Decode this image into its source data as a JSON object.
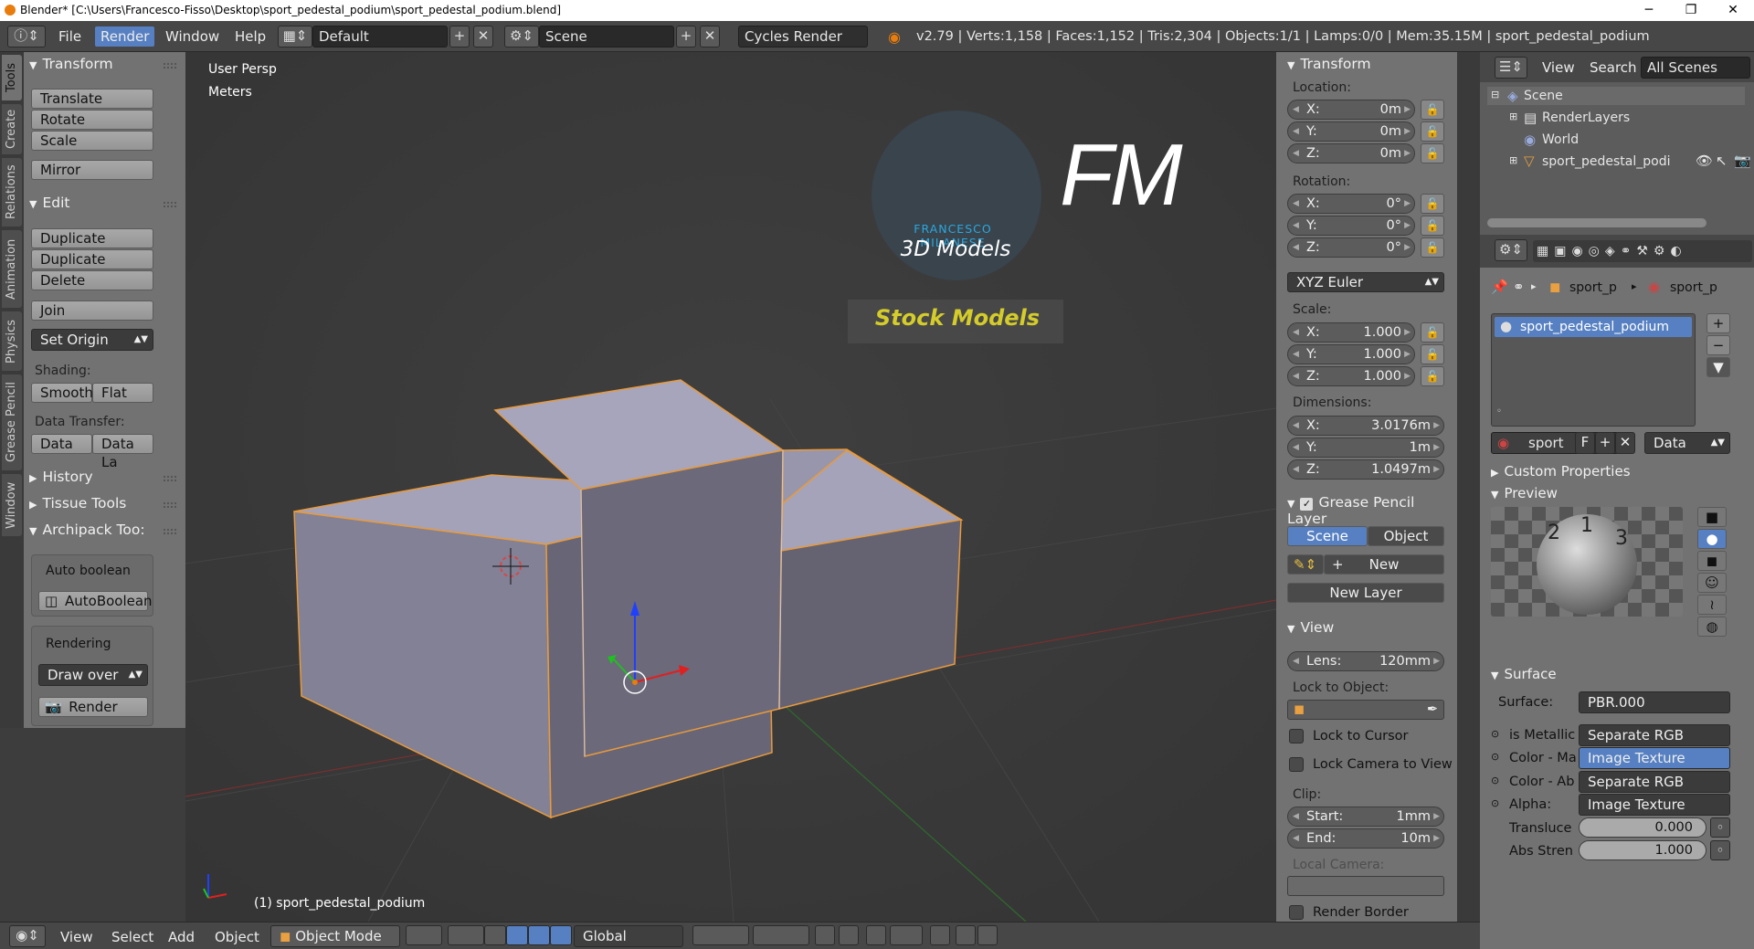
{
  "window": {
    "title": "Blender* [C:\\Users\\Francesco-Fisso\\Desktop\\sport_pedestal_podium\\sport_pedestal_podium.blend]",
    "minimize": "─",
    "maximize": "❐",
    "close": "✕"
  },
  "menubar": {
    "items": [
      "File",
      "Render",
      "Window",
      "Help"
    ],
    "layout": "Default",
    "scene": "Scene",
    "engine": "Cycles Render",
    "stats": "v2.79 | Verts:1,158 | Faces:1,152 | Tris:2,304 | Objects:1/1 | Lamps:0/0 | Mem:35.15M | sport_pedestal_podium"
  },
  "left_tabs": [
    "Tools",
    "Create",
    "Relations",
    "Animation",
    "Physics",
    "Grease Pencil",
    "Window"
  ],
  "toolshelf": {
    "transform": {
      "title": "Transform",
      "buttons": [
        "Translate",
        "Rotate",
        "Scale",
        "Mirror"
      ]
    },
    "edit": {
      "title": "Edit",
      "buttons": [
        "Duplicate",
        "Duplicate Linked",
        "Delete",
        "Join"
      ],
      "set_origin": "Set Origin",
      "shading_label": "Shading:",
      "smooth": "Smooth",
      "flat": "Flat",
      "data_transfer_label": "Data Transfer:",
      "data": "Data",
      "data_la": "Data La"
    },
    "history": "History",
    "tissue": "Tissue Tools",
    "archipack": "Archipack Too:",
    "auto_boolean_label": "Auto boolean",
    "auto_boolean_btn": "AutoBoolean",
    "rendering_label": "Rendering",
    "draw_over": "Draw over",
    "render_btn": "Render"
  },
  "viewport": {
    "view_name": "User Persp",
    "units": "Meters",
    "object_label": "(1) sport_pedestal_podium",
    "logo_fm": "FM",
    "logo_name": "FRANCESCO MILANESE",
    "logo_sub": "3D Models",
    "stock": "Stock Models"
  },
  "npanel": {
    "transform_title": "Transform",
    "location_label": "Location:",
    "loc": [
      "0m",
      "0m",
      "0m"
    ],
    "rotation_label": "Rotation:",
    "rot": [
      "0°",
      "0°",
      "0°"
    ],
    "rotation_mode": "XYZ Euler",
    "scale_label": "Scale:",
    "scale": [
      "1.000",
      "1.000",
      "1.000"
    ],
    "dimensions_label": "Dimensions:",
    "dims": [
      "3.0176m",
      "1m",
      "1.0497m"
    ],
    "axes": [
      "X:",
      "Y:",
      "Z:"
    ],
    "gp_title": "Grease Pencil Layer",
    "gp_scene": "Scene",
    "gp_object": "Object",
    "gp_new": "New",
    "gp_new_layer": "New Layer",
    "view_title": "View",
    "lens_label": "Lens:",
    "lens": "120mm",
    "lock_obj_label": "Lock to Object:",
    "lock_cursor": "Lock to Cursor",
    "lock_camera": "Lock Camera to View",
    "clip_label": "Clip:",
    "clip_start_label": "Start:",
    "clip_start": "1mm",
    "clip_end_label": "End:",
    "clip_end": "10m",
    "local_camera_label": "Local Camera:",
    "render_border": "Render Border"
  },
  "outliner": {
    "view": "View",
    "search": "Search",
    "scenes": "All Scenes",
    "items": [
      "Scene",
      "RenderLayers",
      "World",
      "sport_pedestal_podium"
    ]
  },
  "properties": {
    "breadcrumb": [
      "sport_p",
      "sport_p"
    ],
    "material_slot": "sport_pedestal_podium",
    "mat_name": "sport",
    "f_btn": "F",
    "data_dd": "Data",
    "custom_props": "Custom Properties",
    "preview": "Preview",
    "surface_title": "Surface",
    "surface_label": "Surface:",
    "surface_val": "PBR.000",
    "rows": [
      {
        "label": "is Metallic",
        "val": "Separate RGB"
      },
      {
        "label": "Color - Ma",
        "val": "Image Texture"
      },
      {
        "label": "Color - Ab",
        "val": "Separate RGB"
      },
      {
        "label": "Alpha:",
        "val": "Image Texture"
      }
    ],
    "transluce_label": "Transluce",
    "transluce": "0.000",
    "abs_label": "Abs Stren",
    "abs": "1.000"
  },
  "bottombar": {
    "items": [
      "View",
      "Select",
      "Add",
      "Object"
    ],
    "mode": "Object Mode",
    "orientation": "Global"
  }
}
